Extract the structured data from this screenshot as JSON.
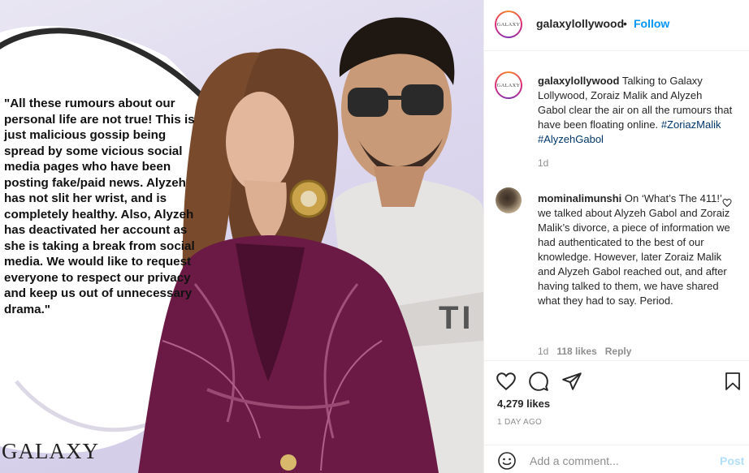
{
  "post_image": {
    "quote": "\"All these rumours about our personal life are not true! This is just malicious gossip being spread by some vicious social media pages who have been posting fake/paid news. Alyzeh has not slit her wrist, and is completely healthy. Also, Alyzeh has deactivated her account as she is taking a break from social media. We would like to request everyone to respect our privacy and keep us out of unnecessary drama.\"",
    "watermark": "GALAXY",
    "shirt_text": "TI"
  },
  "header": {
    "avatar_logo": "GALAXY",
    "username": "galaxylollywood",
    "separator": "•",
    "follow_label": "Follow"
  },
  "caption": {
    "username": "galaxylollywood",
    "text": "Talking to Galaxy Lollywood, Zoraiz Malik and Alyzeh Gabol clear the air on all the rumours that have been floating online.",
    "hashtags": "#ZoriazMalik #AlyzehGabol",
    "time": "1d"
  },
  "comment": {
    "username": "mominalimunshi",
    "text": "On ‘What’s The 411!’ we talked about Alyzeh Gabol and Zoraiz Malik’s divorce, a piece of information we had authenticated to the best of our knowledge. However, later Zoraiz Malik and Alyzeh Gabol reached out, and after having talked to them, we have shared what they had to say. Period.",
    "time": "1d",
    "likes": "118 likes",
    "reply_label": "Reply"
  },
  "actions": {
    "likes_count": "4,279 likes",
    "posted": "1 DAY AGO"
  },
  "add_comment": {
    "placeholder": "Add a comment...",
    "post_label": "Post"
  },
  "colors": {
    "follow": "#0095f6",
    "hashtag": "#00376b",
    "muted": "#8e8e8e",
    "post_disabled": "#b2dffc"
  },
  "icons": [
    "heart-icon",
    "comment-icon",
    "share-icon",
    "bookmark-icon",
    "emoji-icon",
    "comment-like-icon"
  ]
}
